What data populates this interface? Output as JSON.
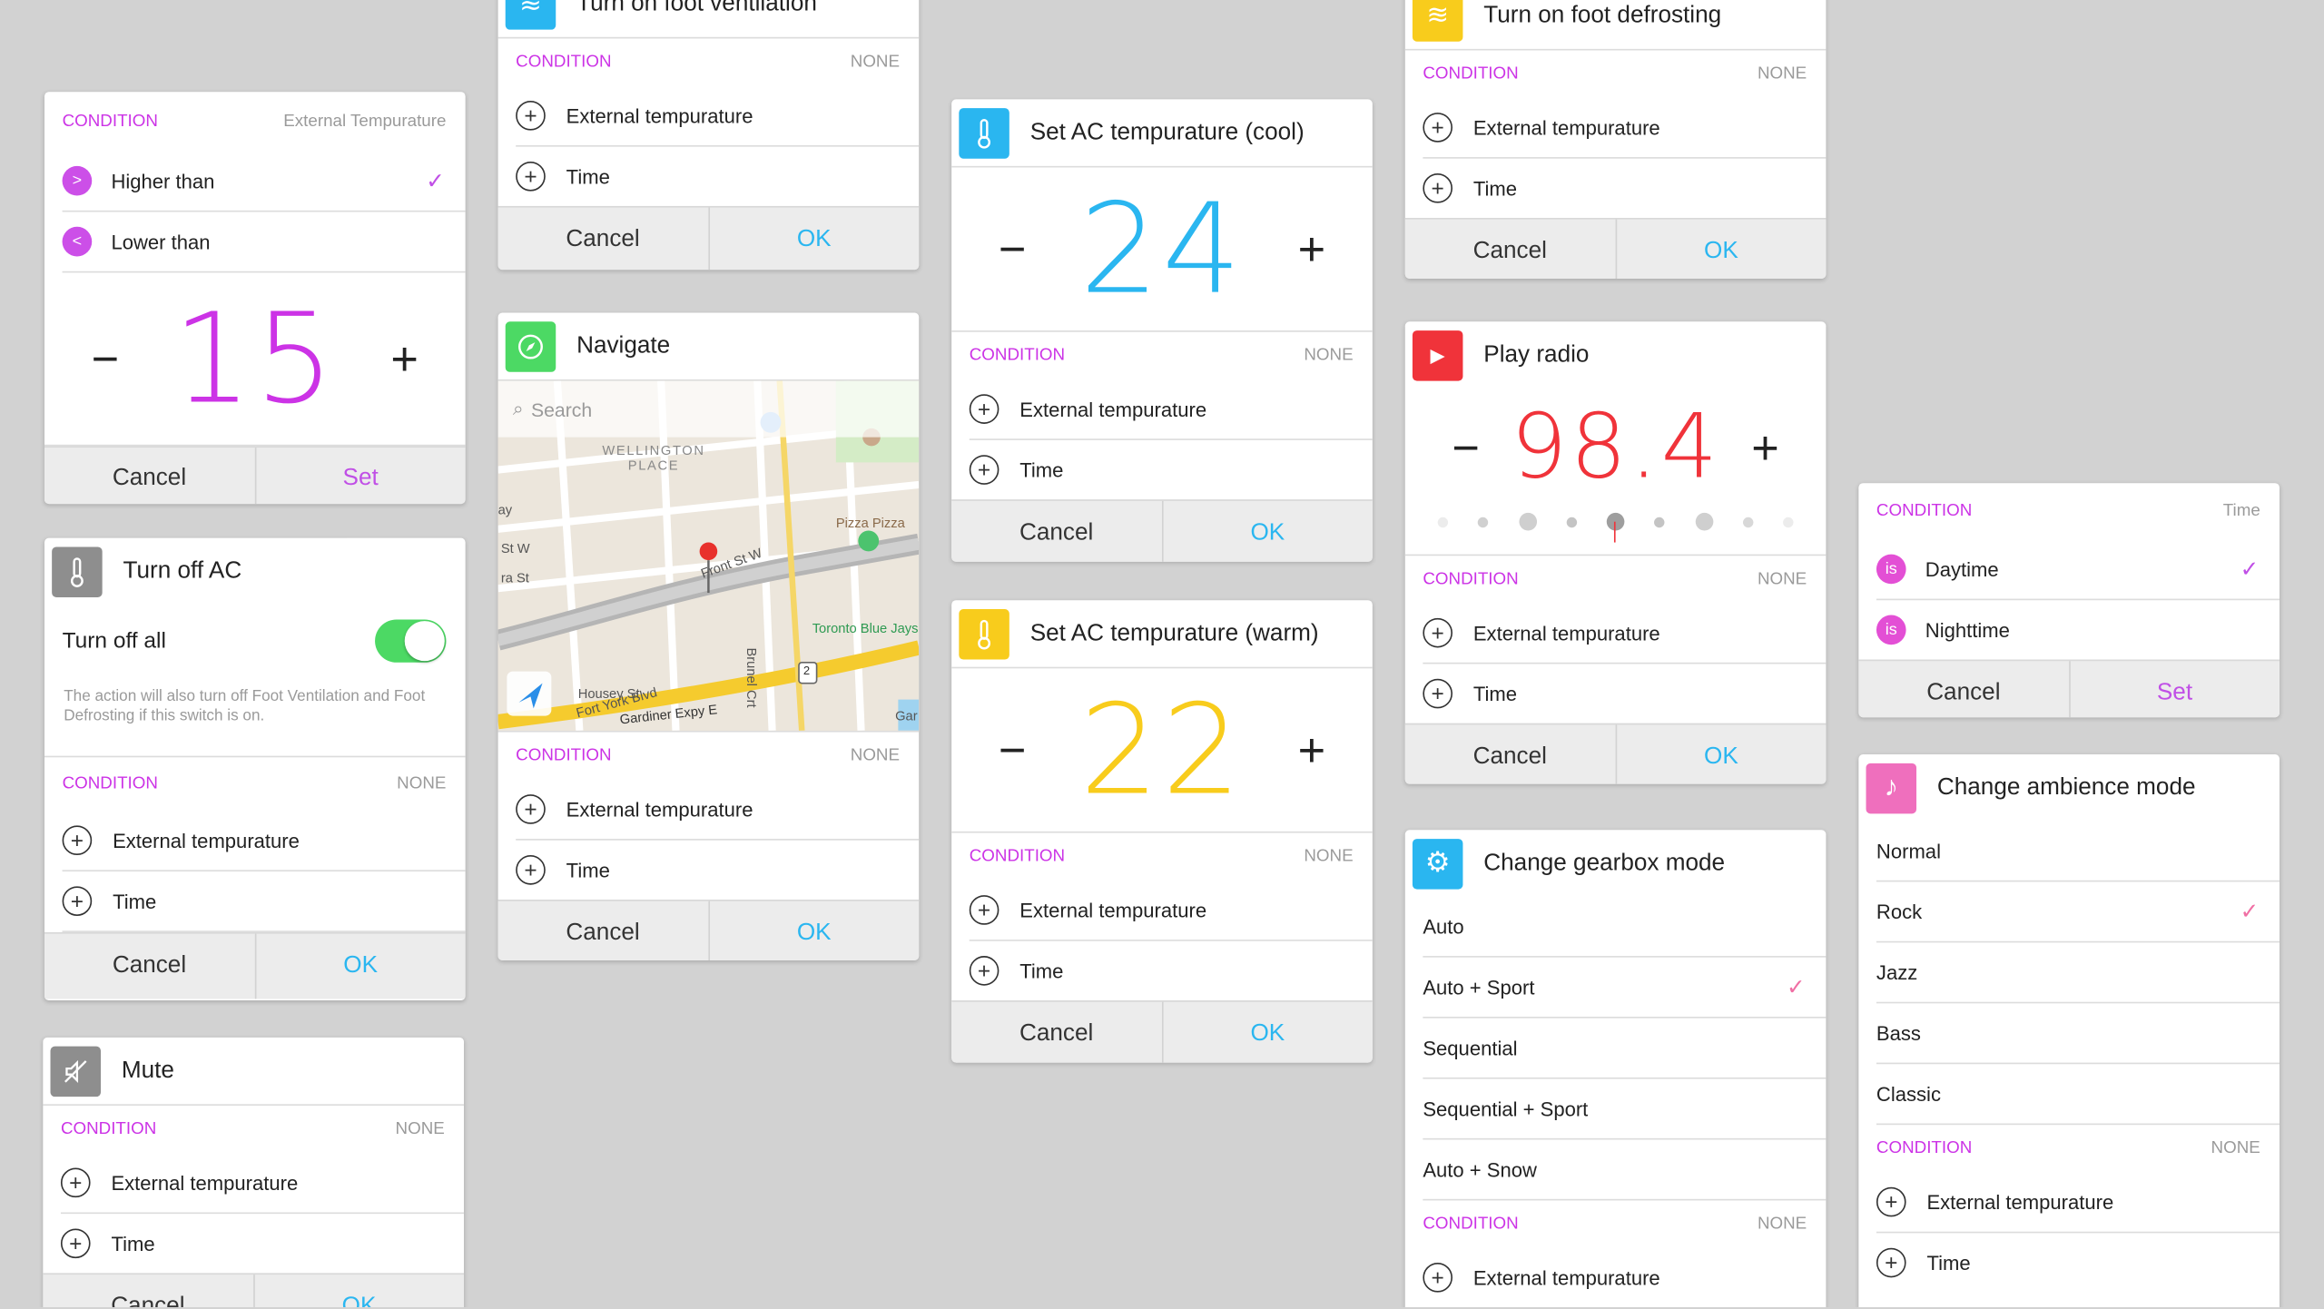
{
  "labels": {
    "condition": "CONDITION",
    "none": "NONE",
    "ext_temp": "External tempurature",
    "time": "Time",
    "cancel": "Cancel",
    "ok": "OK",
    "set": "Set"
  },
  "temp_card": {
    "cond_value": "External Tempurature",
    "options": [
      "Higher than",
      "Lower than"
    ],
    "option_symbols": [
      ">",
      "<"
    ],
    "value": "15",
    "minus": "−",
    "plus": "+"
  },
  "ac_off": {
    "title": "Turn off AC",
    "switch_label": "Turn off all",
    "switch_on": true,
    "note": "The action will also turn off Foot Ventilation and Foot Defrosting if this switch is on."
  },
  "mute": {
    "title": "Mute"
  },
  "vent": {
    "title": "Turn on foot ventilation"
  },
  "navigate": {
    "title": "Navigate",
    "search_placeholder": "Search",
    "map_labels": [
      "WELLINGTON PLACE",
      "Front St W",
      "Pizza Pizza",
      "Toronto Blue Jays",
      "Fort York Blvd",
      "Housey St",
      "Gardiner Expy E",
      "Brunel Crt",
      "St W",
      "ra St",
      "ay",
      "Gar",
      "2"
    ]
  },
  "ac_cool": {
    "title": "Set AC tempurature (cool)",
    "value": "24"
  },
  "ac_warm": {
    "title": "Set AC tempurature (warm)",
    "value": "22"
  },
  "defrost": {
    "title": "Turn on foot defrosting"
  },
  "radio": {
    "title": "Play radio",
    "value": "98.4"
  },
  "gearbox": {
    "title": "Change gearbox mode",
    "options": [
      "Auto",
      "Auto + Sport",
      "Sequential",
      "Sequential + Sport",
      "Auto + Snow"
    ]
  },
  "daytime": {
    "cond_value": "Time",
    "options": [
      "Daytime",
      "Nighttime"
    ],
    "badge": "is"
  },
  "ambience": {
    "title": "Change ambience mode",
    "options": [
      "Normal",
      "Rock",
      "Jazz",
      "Bass",
      "Classic"
    ]
  },
  "colors": {
    "purple": "#cc33e6",
    "blue": "#2ab6f0",
    "red": "#f0333a",
    "yellow": "#f8cc1c",
    "green": "#4cd964"
  }
}
